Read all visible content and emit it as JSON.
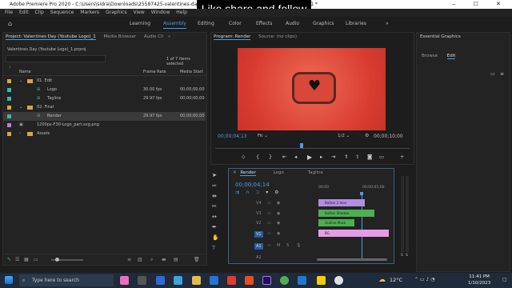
{
  "window": {
    "title": "Adobe Premiere Pro 2020 - C:\\Users\\sidra\\Downloads\\25587425-valentines-day-youtube-logo\\Valentines Day (Youtube Logo)_1 *"
  },
  "overlay": {
    "text": "Like,share and follow"
  },
  "menu": [
    "File",
    "Edit",
    "Clip",
    "Sequence",
    "Markers",
    "Graphics",
    "View",
    "Window",
    "Help"
  ],
  "workspaces": [
    "Learning",
    "Assembly",
    "Editing",
    "Color",
    "Effects",
    "Audio",
    "Graphics",
    "Libraries"
  ],
  "workspace_more": "»",
  "project": {
    "tabs": [
      "Project: Valentines Day (Youtube Logo)_1",
      "Media Browser",
      "Audio Cli"
    ],
    "more": "»",
    "file": "Valentines Day (Youtube Logo)_1.prproj",
    "count": "1 of 7 items selected",
    "cols": [
      "Name",
      "Frame Rate",
      "Media Start"
    ],
    "rows": [
      {
        "name": "01. Edit",
        "fps": "",
        "start": ""
      },
      {
        "name": "Logo",
        "fps": "30.00 fps",
        "start": "00;00;00;00"
      },
      {
        "name": "Tagline",
        "fps": "29.97 fps",
        "start": "00;00;00;00"
      },
      {
        "name": "02. Final",
        "fps": "",
        "start": ""
      },
      {
        "name": "Render",
        "fps": "29.97 fps",
        "start": "00;00;00;00"
      },
      {
        "name": "1200px-F30-Logo_part.svg.png",
        "fps": "",
        "start": ""
      },
      {
        "name": "Assets",
        "fps": "",
        "start": ""
      }
    ]
  },
  "program": {
    "tabs": [
      "Program: Render",
      "Source: (no clips)"
    ],
    "timecode": "00;00;04;13",
    "fit": "Fit",
    "ratio": "1/2",
    "duration": "00;00;10;00"
  },
  "essential": {
    "title": "Essential Graphics",
    "tabs": [
      "Browse",
      "Edit"
    ]
  },
  "timeline": {
    "tabs": [
      "Render",
      "Logo",
      "Tagline"
    ],
    "timecode": "00;00;04;14",
    "ruler": [
      "00;00",
      "00;00;05;00"
    ],
    "tracks": [
      "V4",
      "V3",
      "V2",
      "V1",
      "A1",
      "A2"
    ],
    "clips": [
      "Button 2.mov",
      "Button Shadow",
      "Outline Mask",
      "BG"
    ],
    "meter": [
      "S",
      "S"
    ]
  },
  "taskbar": {
    "search": "Type here to search",
    "weather": "12°C",
    "time": "11:41 PM",
    "date": "1/10/2023"
  },
  "colors": {
    "accent": "#4a9be8",
    "video_bg": "#e0483b",
    "clip_pink": "#e59de6",
    "clip_green": "#4caf50",
    "clip_purple": "#b08ee0"
  }
}
